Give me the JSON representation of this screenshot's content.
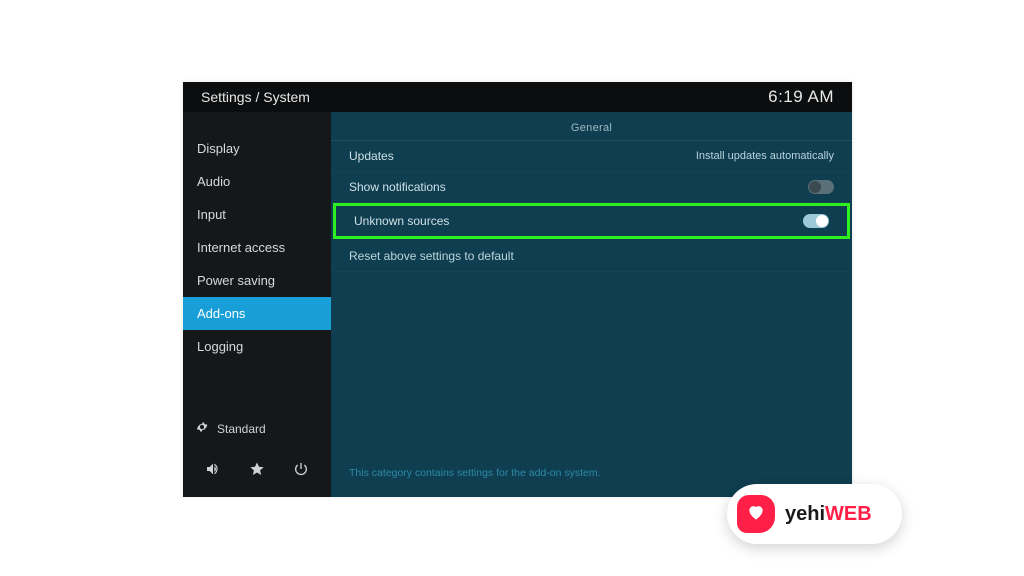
{
  "header": {
    "breadcrumb": "Settings / System",
    "clock": "6:19 AM"
  },
  "sidebar": {
    "items": [
      {
        "label": "Display"
      },
      {
        "label": "Audio"
      },
      {
        "label": "Input"
      },
      {
        "label": "Internet access"
      },
      {
        "label": "Power saving"
      },
      {
        "label": "Add-ons"
      },
      {
        "label": "Logging"
      }
    ],
    "active_index": 5,
    "level_label": "Standard"
  },
  "content": {
    "section_title": "General",
    "rows": {
      "updates": {
        "label": "Updates",
        "value": "Install updates automatically"
      },
      "show_notifications": {
        "label": "Show notifications",
        "toggle": "off"
      },
      "unknown_sources": {
        "label": "Unknown sources",
        "toggle": "on"
      },
      "reset": {
        "label": "Reset above settings to default"
      }
    },
    "footer_hint": "This category contains settings for the add-on system."
  },
  "watermark": {
    "text_main": "yehi",
    "text_sub": "WEB"
  }
}
